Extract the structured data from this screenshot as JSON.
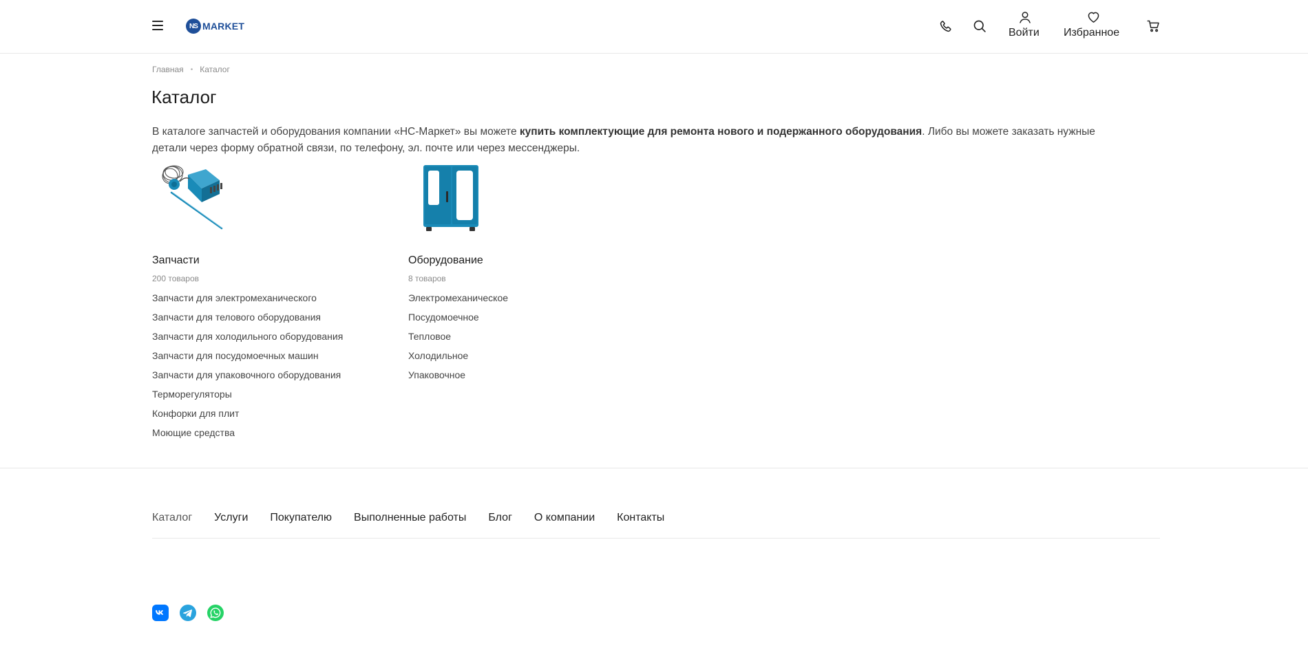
{
  "header": {
    "logo_mark": "NS",
    "logo_text": "MARKET",
    "login_label": "Войти",
    "favorites_label": "Избранное"
  },
  "breadcrumb": {
    "home": "Главная",
    "current": "Каталог"
  },
  "page": {
    "title": "Каталог",
    "intro_start": "В каталоге запчастей и оборудования компании «НС-Маркет» вы можете ",
    "intro_bold": "купить комплектующие для ремонта нового и подержанного оборудования",
    "intro_end": ". Либо вы можете заказать нужные детали через форму обратной связи, по телефону, эл. почте или через мессенджеры."
  },
  "categories": [
    {
      "title": "Запчасти",
      "count": "200 товаров",
      "items": [
        "Запчасти для электромеханического",
        "Запчасти для телового оборудования",
        "Запчасти для холодильного оборудования",
        "Запчасти для посудомоечных машин",
        "Запчасти для упаковочного оборудования",
        "Терморегуляторы",
        "Конфорки для плит",
        "Моющие средства"
      ]
    },
    {
      "title": "Оборудование",
      "count": "8 товаров",
      "items": [
        "Электромеханическое",
        "Посудомоечное",
        "Тепловое",
        "Холодильное",
        "Упаковочное"
      ]
    }
  ],
  "footer": {
    "nav": [
      "Каталог",
      "Услуги",
      "Покупателю",
      "Выполненные работы",
      "Блог",
      "О компании",
      "Контакты"
    ]
  },
  "colors": {
    "brand": "#1f4f99",
    "product_blue": "#1a8bb8",
    "vk": "#0077ff",
    "telegram": "#2aa3de",
    "whatsapp": "#25d366"
  },
  "icons": {
    "menu": "hamburger-icon",
    "phone": "phone-icon",
    "search": "search-icon",
    "user": "user-icon",
    "favorites": "heart-icon",
    "cart": "cart-icon",
    "socials": [
      "vk-icon",
      "telegram-icon",
      "whatsapp-icon"
    ]
  }
}
